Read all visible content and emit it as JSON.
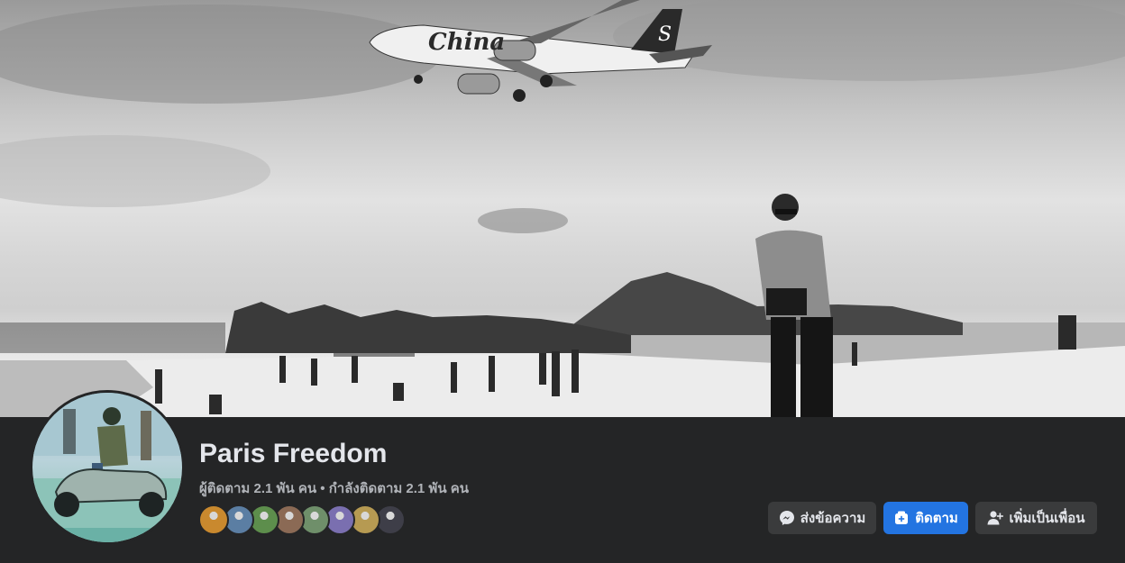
{
  "profile": {
    "name": "Paris Freedom",
    "stats": "ผู้ติดตาม 2.1 พัน คน • กำลังติดตาม 2.1 พัน คน"
  },
  "cover": {
    "airplane_text": "China",
    "airplane_tail_text": "S"
  },
  "mutual_friends": [
    {
      "color": "#c9892e"
    },
    {
      "color": "#5b7ea3"
    },
    {
      "color": "#5d8e4c"
    },
    {
      "color": "#8b6a55"
    },
    {
      "color": "#6f8f6a"
    },
    {
      "color": "#7a6fb0"
    },
    {
      "color": "#b69a52"
    },
    {
      "color": "#3e3e48"
    }
  ],
  "actions": {
    "message_label": "ส่งข้อความ",
    "follow_label": "ติดตาม",
    "add_friend_label": "เพิ่มเป็นเพื่อน"
  },
  "colors": {
    "background": "#242526",
    "primary_button": "#2374e1",
    "secondary_button": "#3a3b3c"
  }
}
